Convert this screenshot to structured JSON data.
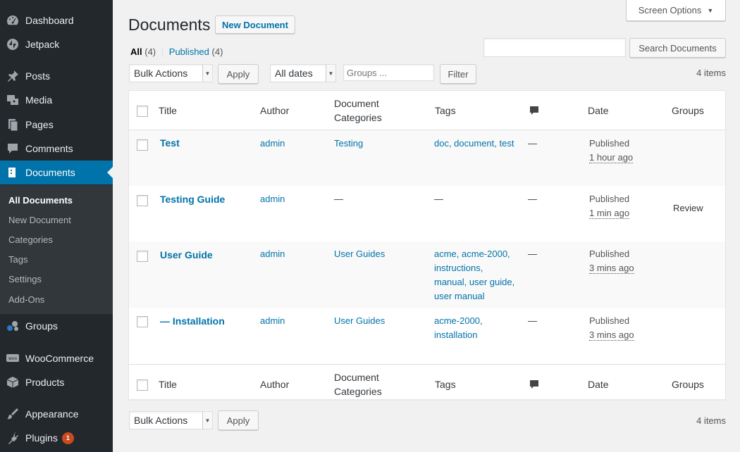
{
  "sidebar": {
    "items": [
      {
        "label": "Dashboard",
        "icon": "dashboard-icon"
      },
      {
        "label": "Jetpack",
        "icon": "jetpack-icon"
      },
      {
        "label": "Posts",
        "icon": "pin-icon"
      },
      {
        "label": "Media",
        "icon": "media-icon"
      },
      {
        "label": "Pages",
        "icon": "pages-icon"
      },
      {
        "label": "Comments",
        "icon": "comment-icon"
      },
      {
        "label": "Documents",
        "icon": "document-icon",
        "active": true
      },
      {
        "label": "Groups",
        "icon": "groups-icon"
      },
      {
        "label": "WooCommerce",
        "icon": "woocommerce-icon"
      },
      {
        "label": "Products",
        "icon": "products-icon"
      },
      {
        "label": "Appearance",
        "icon": "brush-icon"
      },
      {
        "label": "Plugins",
        "icon": "plugin-icon",
        "badge": "1"
      }
    ],
    "submenu": [
      "All Documents",
      "New Document",
      "Categories",
      "Tags",
      "Settings",
      "Add-Ons"
    ]
  },
  "colors": {
    "sidebar_bg": "#23282d",
    "active": "#0073aa",
    "link": "#0073aa",
    "badge": "#ca4a1f"
  },
  "header": {
    "title": "Documents",
    "new_button": "New Document",
    "screen_options": "Screen Options"
  },
  "filters": {
    "all_label": "All",
    "all_count": "(4)",
    "separator": "|",
    "published_label": "Published",
    "published_count": "(4)",
    "bulk_actions": "Bulk Actions",
    "apply": "Apply",
    "dates": "All dates",
    "groups_placeholder": "Groups ...",
    "filter": "Filter",
    "search_button": "Search Documents",
    "items_count": "4 items"
  },
  "table": {
    "columns": {
      "title": "Title",
      "author": "Author",
      "categories_1": "Document",
      "categories_2": "Categories",
      "tags": "Tags",
      "date": "Date",
      "groups": "Groups"
    },
    "rows": [
      {
        "title": "Test",
        "author": "admin",
        "category": "Testing",
        "tags": [
          [
            "doc, document, test"
          ]
        ],
        "comments": "—",
        "status": "Published",
        "date": "1 hour ago",
        "groups": ""
      },
      {
        "title": "Testing Guide",
        "author": "admin",
        "category": "—",
        "tags": [
          [
            "—"
          ]
        ],
        "comments": "—",
        "status": "Published",
        "date": "1 min ago",
        "groups": "Review"
      },
      {
        "title": "User Guide",
        "author": "admin",
        "category": "User Guides",
        "tags": [
          [
            "acme, acme-2000,"
          ],
          [
            "instructions,"
          ],
          [
            "manual, user guide,"
          ],
          [
            "user manual"
          ]
        ],
        "comments": "—",
        "status": "Published",
        "date": "3 mins ago",
        "groups": ""
      },
      {
        "title": "— Installation",
        "author": "admin",
        "category": "User Guides",
        "tags": [
          [
            "acme-2000,"
          ],
          [
            "installation"
          ]
        ],
        "comments": "—",
        "status": "Published",
        "date": "3 mins ago",
        "groups": ""
      }
    ]
  }
}
